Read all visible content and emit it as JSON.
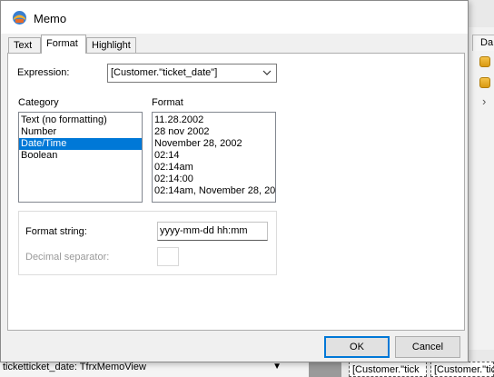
{
  "background": {
    "right_tab_label": "Da",
    "status_text": "ticketticket_date: TfrxMemoView",
    "band_cells": [
      "[Customer.\"tick",
      "[Customer.\"tick"
    ]
  },
  "dialog": {
    "title": "Memo",
    "tabs": [
      {
        "label": "Text",
        "active": false
      },
      {
        "label": "Format",
        "active": true
      },
      {
        "label": "Highlight",
        "active": false
      }
    ],
    "expression_label": "Expression:",
    "expression_value": "[Customer.\"ticket_date\"]",
    "category_label": "Category",
    "format_label": "Format",
    "categories": [
      "Text (no formatting)",
      "Number",
      "Date/Time",
      "Boolean"
    ],
    "selected_category": "Date/Time",
    "formats": [
      "11.28.2002",
      "28 nov 2002",
      "November 28, 2002",
      "02:14",
      "02:14am",
      "02:14:00",
      "02:14am, November 28, 20"
    ],
    "format_string_label": "Format string:",
    "format_string_value": "yyyy-mm-dd hh:mm",
    "decimal_separator_label": "Decimal separator:",
    "decimal_separator_value": "",
    "ok_label": "OK",
    "cancel_label": "Cancel"
  },
  "colors": {
    "selection": "#0078d7",
    "dialog_bg": "#f0f0f0",
    "page_bg": "#ffffff"
  },
  "icons": [
    "memo-app-icon",
    "database-icon",
    "chevron-right-icon",
    "chevron-down-icon"
  ]
}
